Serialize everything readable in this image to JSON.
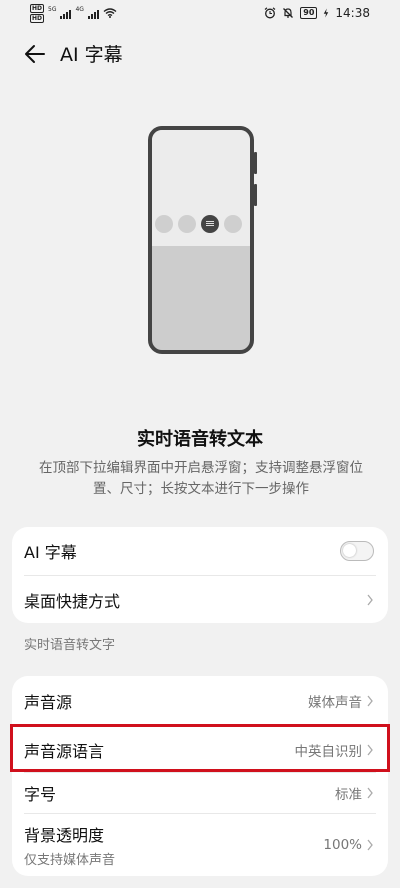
{
  "status_bar": {
    "hd1": "HD",
    "hd2": "HD",
    "signal1_label": "5G",
    "signal2_label": "4G",
    "battery": "90",
    "time": "14:38"
  },
  "header": {
    "title": "AI 字幕"
  },
  "intro": {
    "title": "实时语音转文本",
    "description": "在顶部下拉编辑界面中开启悬浮窗；支持调整悬浮窗位置、尺寸；长按文本进行下一步操作"
  },
  "card1": {
    "ai_caption_label": "AI 字幕",
    "ai_caption_enabled": false,
    "desktop_shortcut_label": "桌面快捷方式"
  },
  "section_label": "实时语音转文字",
  "card2": {
    "sound_source_label": "声音源",
    "sound_source_value": "媒体声音",
    "source_language_label": "声音源语言",
    "source_language_value": "中英自识别",
    "font_size_label": "字号",
    "font_size_value": "标准",
    "bg_opacity_label": "背景透明度",
    "bg_opacity_sub": "仅支持媒体声音",
    "bg_opacity_value": "100%"
  },
  "colors": {
    "highlight": "#d0101c",
    "background": "#f1f1f1"
  }
}
